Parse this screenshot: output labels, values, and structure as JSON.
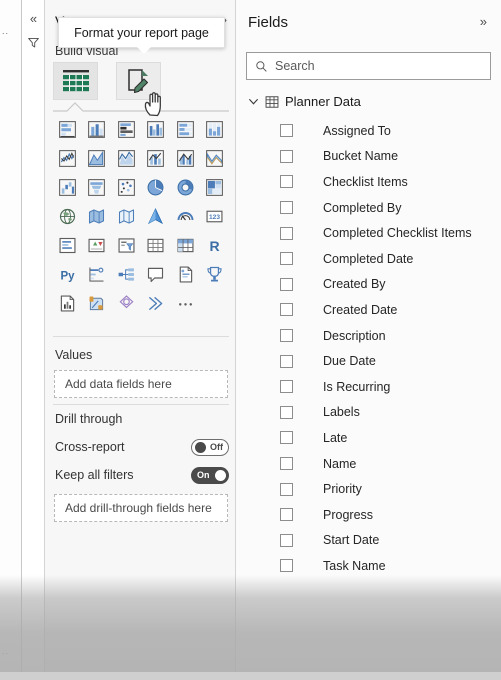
{
  "left_rail": {
    "dots": "..",
    "dots_bottom": "..",
    "collapse_icon": "chevron-double-left-icon",
    "filter_icon": "funnel-icon",
    "label": "Filters"
  },
  "visualizations": {
    "title": "V",
    "full_title": "Visualizations",
    "expand_icon": "chevron-double-right-icon",
    "build_label": "Build visual",
    "tabs": [
      {
        "name": "build-visual",
        "label": "Build visual",
        "icon": "table-green-icon",
        "selected": true
      },
      {
        "name": "format-page",
        "label": "Format your report page",
        "icon": "page-pencil-icon",
        "selected": false
      }
    ],
    "gallery": [
      "stacked-bar-chart-icon",
      "stacked-column-chart-icon",
      "clustered-bar-chart-icon",
      "clustered-column-chart-icon",
      "100-stacked-bar-chart-icon",
      "100-stacked-column-chart-icon",
      "line-chart-icon",
      "area-chart-icon",
      "stacked-area-chart-icon",
      "line-stacked-column-chart-icon",
      "line-clustered-column-chart-icon",
      "ribbon-chart-icon",
      "waterfall-chart-icon",
      "funnel-chart-icon",
      "scatter-chart-icon",
      "pie-chart-icon",
      "donut-chart-icon",
      "treemap-icon",
      "map-icon",
      "filled-map-icon",
      "shape-map-icon",
      "azure-map-icon",
      "gauge-icon",
      "card-icon",
      "multi-row-card-icon",
      "kpi-icon",
      "slicer-icon",
      "table-icon",
      "matrix-icon",
      "r-script-visual-icon",
      "python-visual-icon",
      "key-influencers-icon",
      "decomposition-tree-icon",
      "qna-icon",
      "smart-narrative-icon",
      "metrics-icon",
      "paginated-report-icon",
      "power-apps-icon",
      "power-automate-icon",
      "chevrons-visual-icon",
      "more-options-icon"
    ],
    "values_section": {
      "header": "Values",
      "dropzone": "Add data fields here"
    },
    "drill_through": {
      "header": "Drill through",
      "options": [
        {
          "name": "cross-report",
          "label": "Cross-report",
          "state": "Off",
          "on": false
        },
        {
          "name": "keep-all-filters",
          "label": "Keep all filters",
          "state": "On",
          "on": true
        }
      ],
      "dropzone": "Add drill-through fields here"
    }
  },
  "fields": {
    "title": "Fields",
    "expand_icon": "chevron-double-right-icon",
    "search": {
      "placeholder": "Search",
      "value": "",
      "icon": "search-icon"
    },
    "table": {
      "name": "Planner Data",
      "expanded": true,
      "chevron_icon": "chevron-down-icon",
      "table_icon": "table-grid-icon"
    },
    "items": [
      {
        "label": "Assigned To",
        "checked": false
      },
      {
        "label": "Bucket Name",
        "checked": false
      },
      {
        "label": "Checklist Items",
        "checked": false
      },
      {
        "label": "Completed By",
        "checked": false
      },
      {
        "label": "Completed Checklist Items",
        "checked": false
      },
      {
        "label": "Completed Date",
        "checked": false
      },
      {
        "label": "Created By",
        "checked": false
      },
      {
        "label": "Created Date",
        "checked": false
      },
      {
        "label": "Description",
        "checked": false
      },
      {
        "label": "Due Date",
        "checked": false
      },
      {
        "label": "Is Recurring",
        "checked": false
      },
      {
        "label": "Labels",
        "checked": false
      },
      {
        "label": "Late",
        "checked": false
      },
      {
        "label": "Name",
        "checked": false
      },
      {
        "label": "Priority",
        "checked": false
      },
      {
        "label": "Progress",
        "checked": false
      },
      {
        "label": "Start Date",
        "checked": false
      },
      {
        "label": "Task Name",
        "checked": false
      }
    ]
  },
  "tooltip": {
    "text": "Format your report page"
  },
  "colors": {
    "accent_blue": "#7CA6D8",
    "icon_outline": "#6b6b6b",
    "green": "#1d7a54",
    "toggle_on": "#4a4a4a",
    "panel_bg": "#f7f7f7",
    "fields_bg": "#fbfbfb"
  }
}
